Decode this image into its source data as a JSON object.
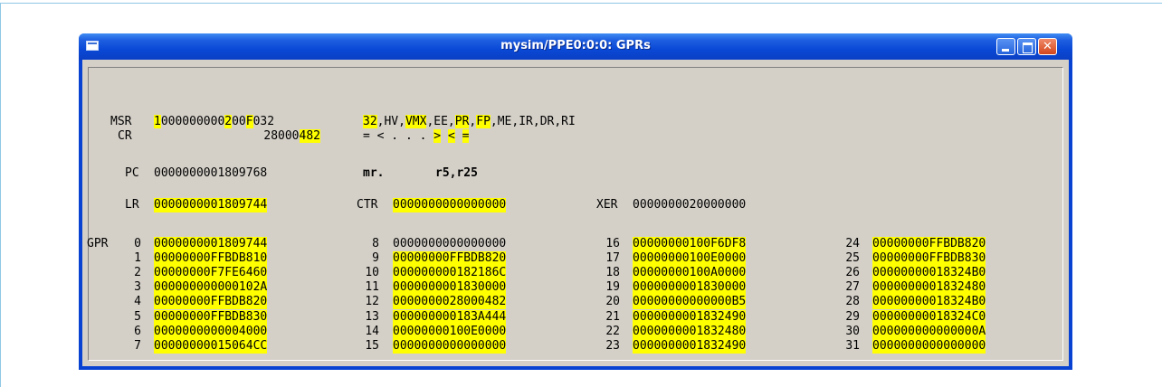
{
  "window": {
    "title": "mysim/PPE0:0:0: GPRs"
  },
  "msr": {
    "label": "MSR",
    "value": [
      {
        "t": "1",
        "h": true
      },
      {
        "t": "000000000",
        "h": false
      },
      {
        "t": "2",
        "h": true
      },
      {
        "t": "00",
        "h": false
      },
      {
        "t": "F",
        "h": true
      },
      {
        "t": "032",
        "h": false
      }
    ],
    "flags": [
      {
        "t": "32",
        "h": true
      },
      {
        "t": ",HV,",
        "h": false
      },
      {
        "t": "VMX",
        "h": true
      },
      {
        "t": ",EE,",
        "h": false
      },
      {
        "t": "PR",
        "h": true
      },
      {
        "t": ",",
        "h": false
      },
      {
        "t": "FP",
        "h": true
      },
      {
        "t": ",ME,IR,DR,RI",
        "h": false
      }
    ]
  },
  "cr": {
    "label": "CR",
    "value": [
      {
        "t": "28000",
        "h": false
      },
      {
        "t": "482",
        "h": true
      }
    ],
    "compare": [
      {
        "t": "= < . . . ",
        "h": false
      },
      {
        "t": ">",
        "h": true
      },
      {
        "t": " ",
        "h": false
      },
      {
        "t": "<",
        "h": true
      },
      {
        "t": " ",
        "h": false
      },
      {
        "t": "=",
        "h": true
      }
    ]
  },
  "pc": {
    "label": "PC",
    "value": "0000000001809768",
    "mnemonic": "mr.",
    "operands": "r5,r25"
  },
  "lr": {
    "label": "LR",
    "value": "0000000001809744",
    "highlight": true
  },
  "ctr": {
    "label": "CTR",
    "value": "0000000000000000",
    "highlight": true
  },
  "xer": {
    "label": "XER",
    "value": "0000000020000000",
    "highlight": false
  },
  "gpr": {
    "label": "GPR",
    "regs": [
      {
        "n": "0",
        "v": "0000000001809744",
        "h": true
      },
      {
        "n": "1",
        "v": "00000000FFBDB810",
        "h": true
      },
      {
        "n": "2",
        "v": "00000000F7FE6460",
        "h": true
      },
      {
        "n": "3",
        "v": "000000000000102A",
        "h": true
      },
      {
        "n": "4",
        "v": "00000000FFBDB820",
        "h": true
      },
      {
        "n": "5",
        "v": "00000000FFBDB830",
        "h": true
      },
      {
        "n": "6",
        "v": "0000000000004000",
        "h": true
      },
      {
        "n": "7",
        "v": "00000000015064CC",
        "h": true
      },
      {
        "n": "8",
        "v": "0000000000000000",
        "h": false
      },
      {
        "n": "9",
        "v": "00000000FFBDB820",
        "h": true
      },
      {
        "n": "10",
        "v": "000000000182186C",
        "h": true
      },
      {
        "n": "11",
        "v": "0000000001830000",
        "h": true
      },
      {
        "n": "12",
        "v": "0000000028000482",
        "h": true
      },
      {
        "n": "13",
        "v": "000000000183A444",
        "h": true
      },
      {
        "n": "14",
        "v": "00000000100E0000",
        "h": true
      },
      {
        "n": "15",
        "v": "0000000000000000",
        "h": true
      },
      {
        "n": "16",
        "v": "00000000100F6DF8",
        "h": true
      },
      {
        "n": "17",
        "v": "00000000100E0000",
        "h": true
      },
      {
        "n": "18",
        "v": "00000000100A0000",
        "h": true
      },
      {
        "n": "19",
        "v": "0000000001830000",
        "h": true
      },
      {
        "n": "20",
        "v": "00000000000000B5",
        "h": true
      },
      {
        "n": "21",
        "v": "0000000001832490",
        "h": true
      },
      {
        "n": "22",
        "v": "0000000001832480",
        "h": true
      },
      {
        "n": "23",
        "v": "0000000001832490",
        "h": true
      },
      {
        "n": "24",
        "v": "00000000FFBDB820",
        "h": true
      },
      {
        "n": "25",
        "v": "00000000FFBDB830",
        "h": true
      },
      {
        "n": "26",
        "v": "00000000018324B0",
        "h": true
      },
      {
        "n": "27",
        "v": "0000000001832480",
        "h": true
      },
      {
        "n": "28",
        "v": "00000000018324B0",
        "h": true
      },
      {
        "n": "29",
        "v": "00000000018324C0",
        "h": true
      },
      {
        "n": "30",
        "v": "000000000000000A",
        "h": true
      },
      {
        "n": "31",
        "v": "0000000000000000",
        "h": true
      }
    ]
  },
  "colors": {
    "highlight": "#FFFF00",
    "client_background": "#D4D0C8",
    "titlebar": "#0A49D6"
  }
}
